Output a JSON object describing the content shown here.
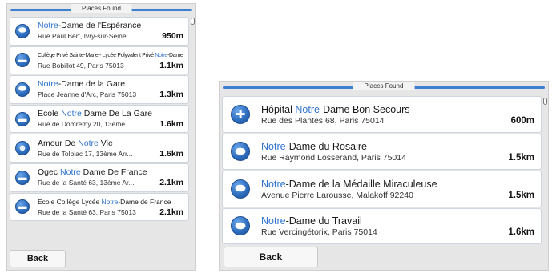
{
  "left_panel": {
    "title": "Places Found",
    "back_label": "Back",
    "items": [
      {
        "pre": "",
        "hl": "Notre",
        "post": "-Dame de l'Espérance",
        "address": "Rue Paul Bert, Ivry-sur-Seine...",
        "distance": "950m",
        "icon": "place-of-worship-icon"
      },
      {
        "pre": "Collège Privé Sainte-Marie - Lycée Polyvalent Privé ",
        "hl": "Notre",
        "post": "-Dame",
        "address": "Rue Bobillot 49, Paris 75013",
        "distance": "1.1km",
        "icon": "school-icon"
      },
      {
        "pre": "",
        "hl": "Notre",
        "post": "-Dame de la Gare",
        "address": "Place Jeanne d'Arc, Paris 75013",
        "distance": "1.3km",
        "icon": "place-of-worship-icon"
      },
      {
        "pre": "Ecole ",
        "hl": "Notre",
        "post": " Dame De La Gare",
        "address": "Rue de Domrémy 20, 13ème...",
        "distance": "1.6km",
        "icon": "school-icon"
      },
      {
        "pre": "Amour De ",
        "hl": "Notre",
        "post": " Vie",
        "address": "Rue de Tolbiac 17, 13ème Arr...",
        "distance": "1.6km",
        "icon": "community-icon"
      },
      {
        "pre": "Ogec ",
        "hl": "Notre",
        "post": " Dame De France",
        "address": "Rue de la Santé 63, 13ème Ar...",
        "distance": "2.1km",
        "icon": "school-icon"
      },
      {
        "pre": "Ecole Collège Lycée ",
        "hl": "Notre",
        "post": "-Dame de France",
        "address": "Rue de la Santé 63, Paris 75013",
        "distance": "2.1km",
        "icon": "school-icon"
      }
    ]
  },
  "right_panel": {
    "title": "Places Found",
    "back_label": "Back",
    "items": [
      {
        "pre": "Hôpital ",
        "hl": "Notre",
        "post": "-Dame Bon Secours",
        "address": "Rue des Plantes 68, Paris 75014",
        "distance": "600m",
        "icon": "hospital-icon"
      },
      {
        "pre": "",
        "hl": "Notre",
        "post": "-Dame du Rosaire",
        "address": "Rue Raymond Losserand, Paris 75014",
        "distance": "1.5km",
        "icon": "place-of-worship-icon"
      },
      {
        "pre": "",
        "hl": "Notre",
        "post": "-Dame de la Médaille Miraculeuse",
        "address": "Avenue Pierre Larousse, Malakoff 92240",
        "distance": "1.5km",
        "icon": "place-of-worship-icon"
      },
      {
        "pre": "",
        "hl": "Notre",
        "post": "-Dame du Travail",
        "address": "Rue Vercingétorix, Paris 75014",
        "distance": "1.6km",
        "icon": "place-of-worship-icon"
      }
    ]
  },
  "colors": {
    "accent": "#3d7fd1",
    "highlight": "#2f73d0",
    "panel": "#e6e6e6"
  }
}
